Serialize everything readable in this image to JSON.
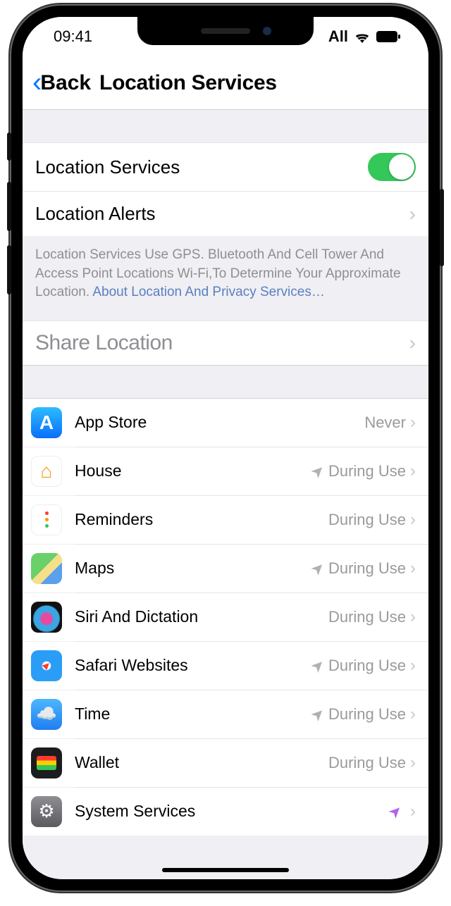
{
  "status": {
    "time": "09:41",
    "carrier": "All"
  },
  "nav": {
    "back": "Back",
    "title": "Location Services"
  },
  "rows": {
    "location_services": "Location Services",
    "location_alerts": "Location Alerts",
    "share_location": "Share Location"
  },
  "footer": {
    "text": "Location Services Use GPS. Bluetooth And Cell Tower And Access Point Locations Wi-Fi,To Determine Your Approximate Location. ",
    "link": "About Location And Privacy Services…"
  },
  "status_labels": {
    "never": "Never",
    "during": "During Use"
  },
  "apps": [
    {
      "name": "App Store",
      "status": "never",
      "arrow": false,
      "icon": "ic-appstore"
    },
    {
      "name": "House",
      "status": "during",
      "arrow": true,
      "icon": "ic-house"
    },
    {
      "name": "Reminders",
      "status": "during",
      "arrow": false,
      "icon": "ic-reminders"
    },
    {
      "name": "Maps",
      "status": "during",
      "arrow": true,
      "icon": "ic-maps"
    },
    {
      "name": "Siri And Dictation",
      "status": "during",
      "arrow": false,
      "icon": "ic-siri"
    },
    {
      "name": "Safari Websites",
      "status": "during",
      "arrow": true,
      "icon": "ic-safari"
    },
    {
      "name": "Time",
      "status": "during",
      "arrow": true,
      "icon": "ic-weather"
    },
    {
      "name": "Wallet",
      "status": "during",
      "arrow": false,
      "icon": "ic-wallet"
    },
    {
      "name": "System Services",
      "status": "",
      "arrow": "purple",
      "icon": "ic-system"
    }
  ]
}
